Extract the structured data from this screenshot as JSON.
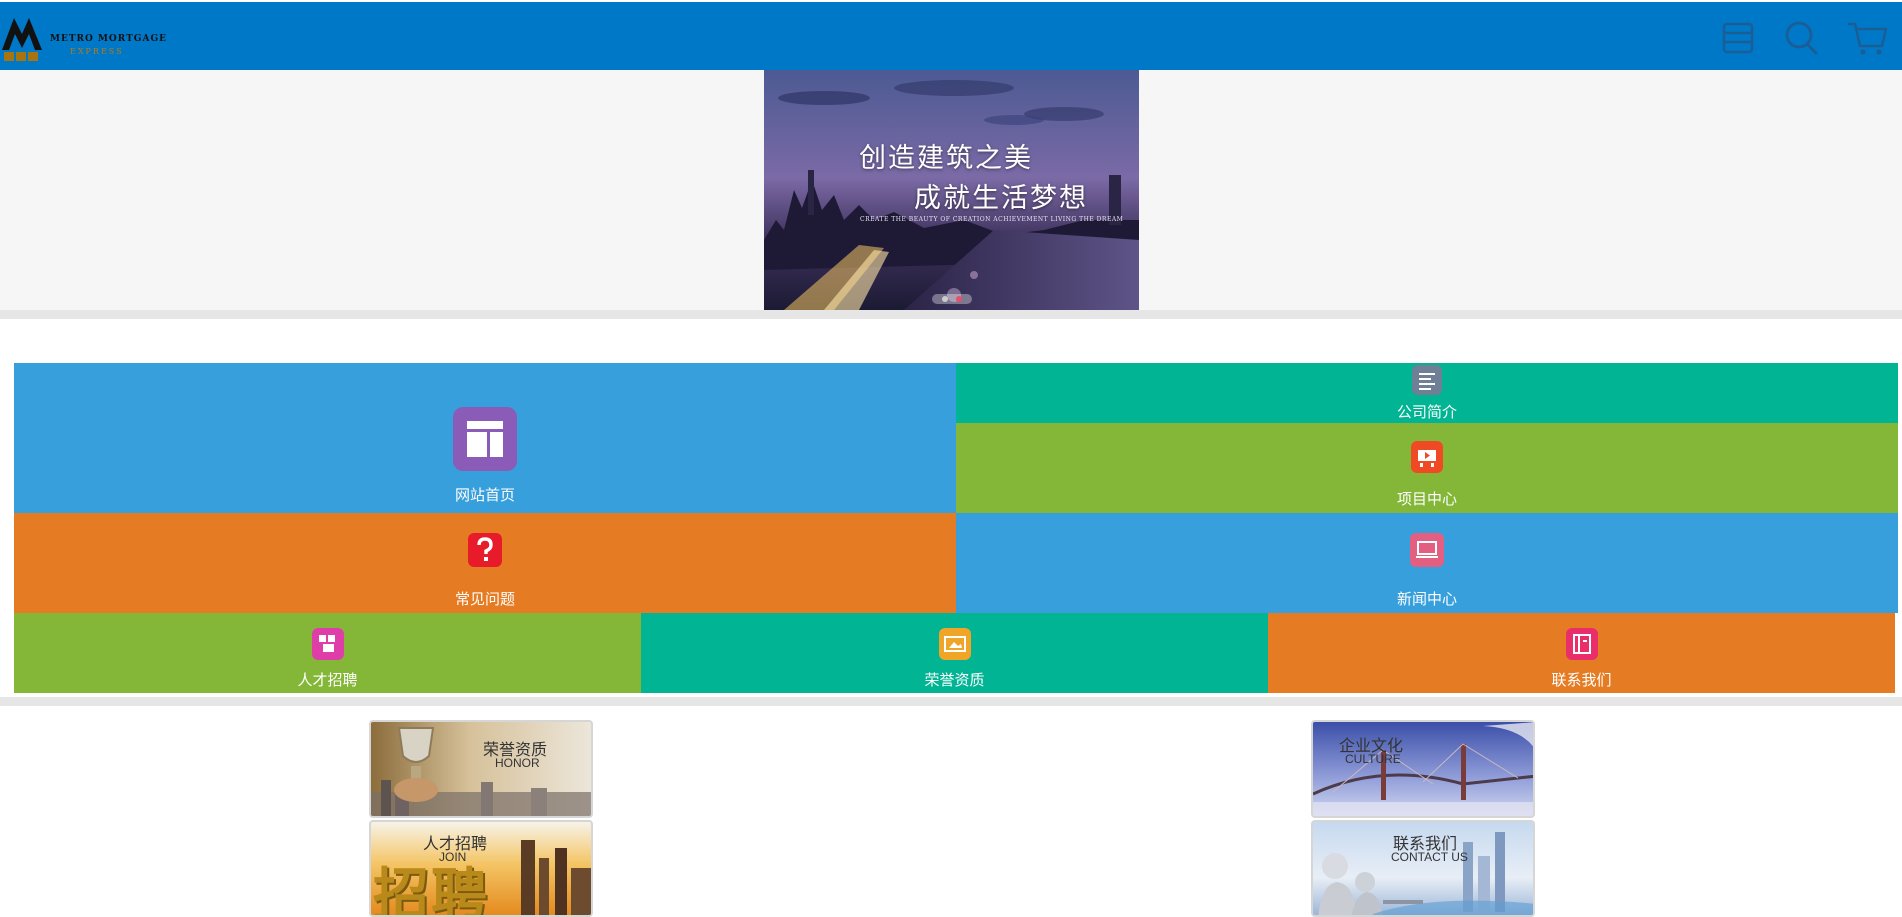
{
  "header": {
    "logo": {
      "line1": "METRO MORTGAGE",
      "line2": "EXPRESS"
    },
    "icons": [
      "menu-icon",
      "search-icon",
      "cart-icon"
    ],
    "bg_color": "#0078c8"
  },
  "banner": {
    "title_line1": "创造建筑之美",
    "title_line2": "成就生活梦想",
    "subtitle": "CREATE THE BEAUTY OF CREATION ACHIEVEMENT LIVING THE DREAM",
    "slides_count": 2,
    "active_slide": 2
  },
  "tiles": [
    {
      "label": "网站首页",
      "icon": "home-layout-icon",
      "color": "#379fdb"
    },
    {
      "label": "公司简介",
      "icon": "document-lines-icon",
      "color": "#00b494"
    },
    {
      "label": "项目中心",
      "icon": "presentation-icon",
      "color": "#84b737"
    },
    {
      "label": "常见问题",
      "icon": "question-icon",
      "color": "#e57c23"
    },
    {
      "label": "新闻中心",
      "icon": "monitor-icon",
      "color": "#379fdb"
    },
    {
      "label": "人才招聘",
      "icon": "people-icon",
      "color": "#84b737"
    },
    {
      "label": "荣誉资质",
      "icon": "image-icon",
      "color": "#00b494"
    },
    {
      "label": "联系我们",
      "icon": "contact-book-icon",
      "color": "#e57c23"
    }
  ],
  "promos": [
    {
      "cn": "荣誉资质",
      "en": "HONOR"
    },
    {
      "cn": "企业文化",
      "en": "CULTURE"
    },
    {
      "cn": "人才招聘",
      "en": "JOIN"
    },
    {
      "cn": "联系我们",
      "en": "CONTACT US"
    }
  ],
  "promo_art_text": "招聘"
}
